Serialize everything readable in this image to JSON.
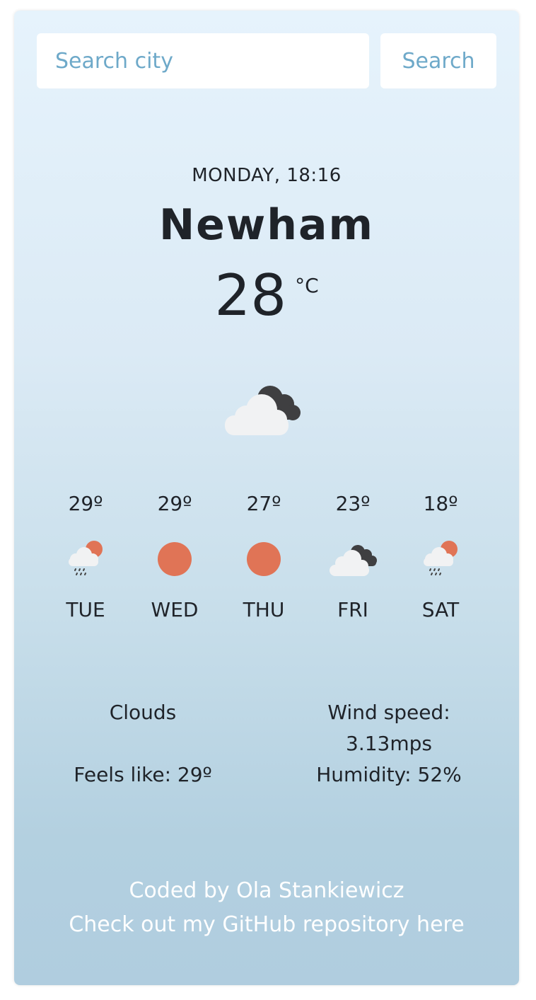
{
  "search": {
    "placeholder": "Search city",
    "button_label": "Search"
  },
  "current": {
    "datetime": "MONDAY, 18:16",
    "city": "Newham",
    "temperature": "28",
    "unit": "°C",
    "icon": "cloudy-icon"
  },
  "forecast": [
    {
      "temp": "29º",
      "day": "TUE",
      "icon": "rain-sun-icon"
    },
    {
      "temp": "29º",
      "day": "WED",
      "icon": "sun-icon"
    },
    {
      "temp": "27º",
      "day": "THU",
      "icon": "sun-icon"
    },
    {
      "temp": "23º",
      "day": "FRI",
      "icon": "cloudy-icon"
    },
    {
      "temp": "18º",
      "day": "SAT",
      "icon": "rain-sun-icon"
    }
  ],
  "details": {
    "description": "Clouds",
    "feels_like": "Feels like: 29º",
    "wind_label": "Wind speed:",
    "wind_value": "3.13mps",
    "humidity": "Humidity: 52%"
  },
  "footer": {
    "line1": "Coded by Ola Stankiewicz",
    "line2": "Check out my GitHub repository here"
  },
  "colors": {
    "accent": "#6ea9c9",
    "sun": "#e07456",
    "text": "#1f2329"
  }
}
